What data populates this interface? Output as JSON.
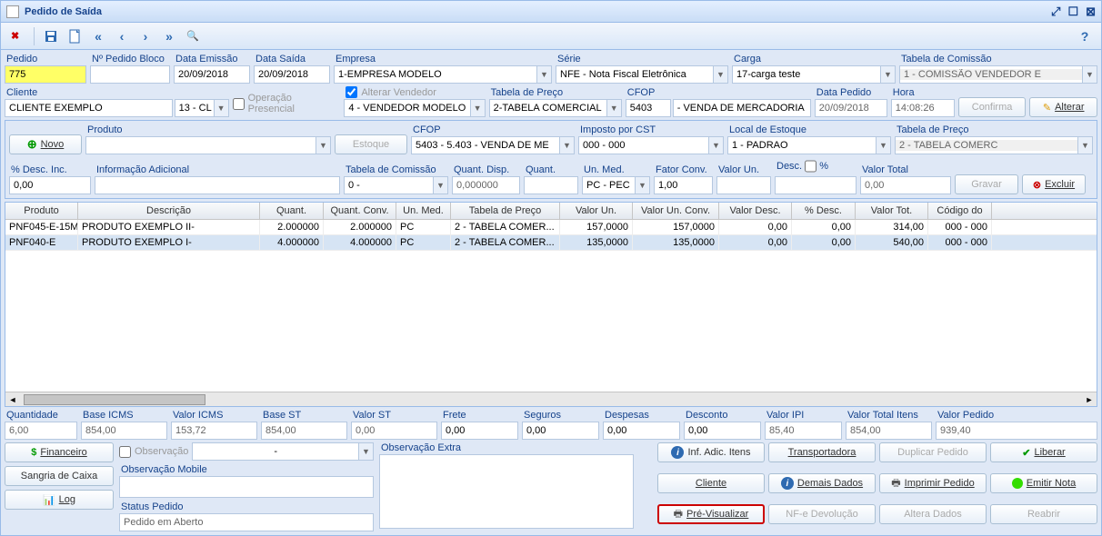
{
  "window": {
    "title": "Pedido de Saída"
  },
  "toolbar": {},
  "header": {
    "pedido_lbl": "Pedido",
    "pedido": "775",
    "npedido_lbl": "Nº Pedido Bloco",
    "npedido": "",
    "emissao_lbl": "Data Emissão",
    "emissao": "20/09/2018",
    "saida_lbl": "Data Saída",
    "saida": "20/09/2018",
    "empresa_lbl": "Empresa",
    "empresa": "1-EMPRESA MODELO",
    "serie_lbl": "Série",
    "serie": "NFE   - Nota Fiscal Eletrônica",
    "carga_lbl": "Carga",
    "carga": "17-carga teste",
    "comissao_lbl": "Tabela de Comissão",
    "comissao": "1 - COMISSÃO VENDEDOR E",
    "cliente_lbl": "Cliente",
    "cliente": "CLIENTE EXEMPLO",
    "cliente_cod": "13 - CL",
    "op_presencial": "Operação Presencial",
    "alt_vendedor": "Alterar Vendedor",
    "vendedor": "4 - VENDEDOR MODELO",
    "tabpreco_lbl": "Tabela de Preço",
    "tabpreco": "2-TABELA COMERCIAL",
    "cfop_lbl": "CFOP",
    "cfop_cod": "5403",
    "cfop_desc": "- VENDA DE MERCADORIA",
    "datapedido_lbl": "Data Pedido",
    "datapedido": "20/09/2018",
    "hora_lbl": "Hora",
    "hora": "14:08:26",
    "confirma": "Confirma",
    "alterar": "Alterar"
  },
  "item": {
    "novo": "Novo",
    "produto_lbl": "Produto",
    "produto": "",
    "estoque": "Estoque",
    "cfop_lbl": "CFOP",
    "cfop": "5403    - 5.403 - VENDA DE ME",
    "imposto_lbl": "Imposto por CST",
    "imposto": "000  - 000",
    "local_lbl": "Local de Estoque",
    "local": "1 - PADRAO",
    "tabpreco_lbl": "Tabela de Preço",
    "tabpreco": "2 - TABELA COMERC",
    "desc_inc_lbl": "% Desc. Inc.",
    "desc_inc": "0,00",
    "info_lbl": "Informação Adicional",
    "info": "",
    "comissao_lbl": "Tabela de Comissão",
    "comissao": "0 -",
    "qtdisp_lbl": "Quant. Disp.",
    "qtdisp": "0,000000",
    "qt_lbl": "Quant.",
    "qt": "",
    "un_lbl": "Un. Med.",
    "un": "PC    - PEC",
    "fator_lbl": "Fator Conv.",
    "fator": "1,00",
    "valun_lbl": "Valor Un.",
    "valun": "",
    "desc_lbl": "Desc.",
    "desc": "",
    "pct_chk": "%",
    "vtotal_lbl": "Valor Total",
    "vtotal": "0,00",
    "gravar": "Gravar",
    "excluir": "Excluir"
  },
  "grid": {
    "cols": [
      "Produto",
      "Descrição",
      "Quant.",
      "Quant. Conv.",
      "Un. Med.",
      "Tabela de Preço",
      "Valor Un.",
      "Valor Un. Conv.",
      "Valor Desc.",
      "% Desc.",
      "Valor Tot.",
      "Código do"
    ],
    "rows": [
      {
        "c": [
          "PNF045-E-15M",
          "PRODUTO EXEMPLO II-",
          "2.000000",
          "2.000000",
          "PC",
          "2 - TABELA COMER...",
          "157,0000",
          "157,0000",
          "0,00",
          "0,00",
          "314,00",
          "000  - 000"
        ]
      },
      {
        "c": [
          "PNF040-E",
          "PRODUTO EXEMPLO I-",
          "4.000000",
          "4.000000",
          "PC",
          "2 - TABELA COMER...",
          "135,0000",
          "135,0000",
          "0,00",
          "0,00",
          "540,00",
          "000  - 000"
        ]
      }
    ]
  },
  "totals": {
    "qt_lbl": "Quantidade",
    "qt": "6,00",
    "bicms_lbl": "Base ICMS",
    "bicms": "854,00",
    "vicms_lbl": "Valor ICMS",
    "vicms": "153,72",
    "bst_lbl": "Base ST",
    "bst": "854,00",
    "vst_lbl": "Valor ST",
    "vst": "0,00",
    "frete_lbl": "Frete",
    "frete": "0,00",
    "seg_lbl": "Seguros",
    "seg": "0,00",
    "desp_lbl": "Despesas",
    "desp": "0,00",
    "desc_lbl": "Desconto",
    "desc": "0,00",
    "vipi_lbl": "Valor IPI",
    "vipi": "85,40",
    "vti_lbl": "Valor Total Itens",
    "vti": "854,00",
    "vped_lbl": "Valor Pedido",
    "vped": "939,40"
  },
  "footer": {
    "financeiro": "Financeiro",
    "sangria": "Sangria de Caixa",
    "log": "Log",
    "obs_chk": "Observação",
    "obs_dd": "-",
    "obsm_lbl": "Observação Mobile",
    "obsm": "",
    "status_lbl": "Status Pedido",
    "status": "Pedido em Aberto",
    "obsx_lbl": "Observação Extra",
    "obsx": "",
    "infadic": "Inf. Adic. Itens",
    "transp": "Transportadora",
    "dup": "Duplicar Pedido",
    "liberar": "Liberar",
    "cliente": "Cliente",
    "demais": "Demais Dados",
    "imprimir": "Imprimir Pedido",
    "emitir": "Emitir Nota",
    "previs": "Pré-Visualizar",
    "nfedev": "NF-e Devolução",
    "altdados": "Altera Dados",
    "reabrir": "Reabrir"
  }
}
